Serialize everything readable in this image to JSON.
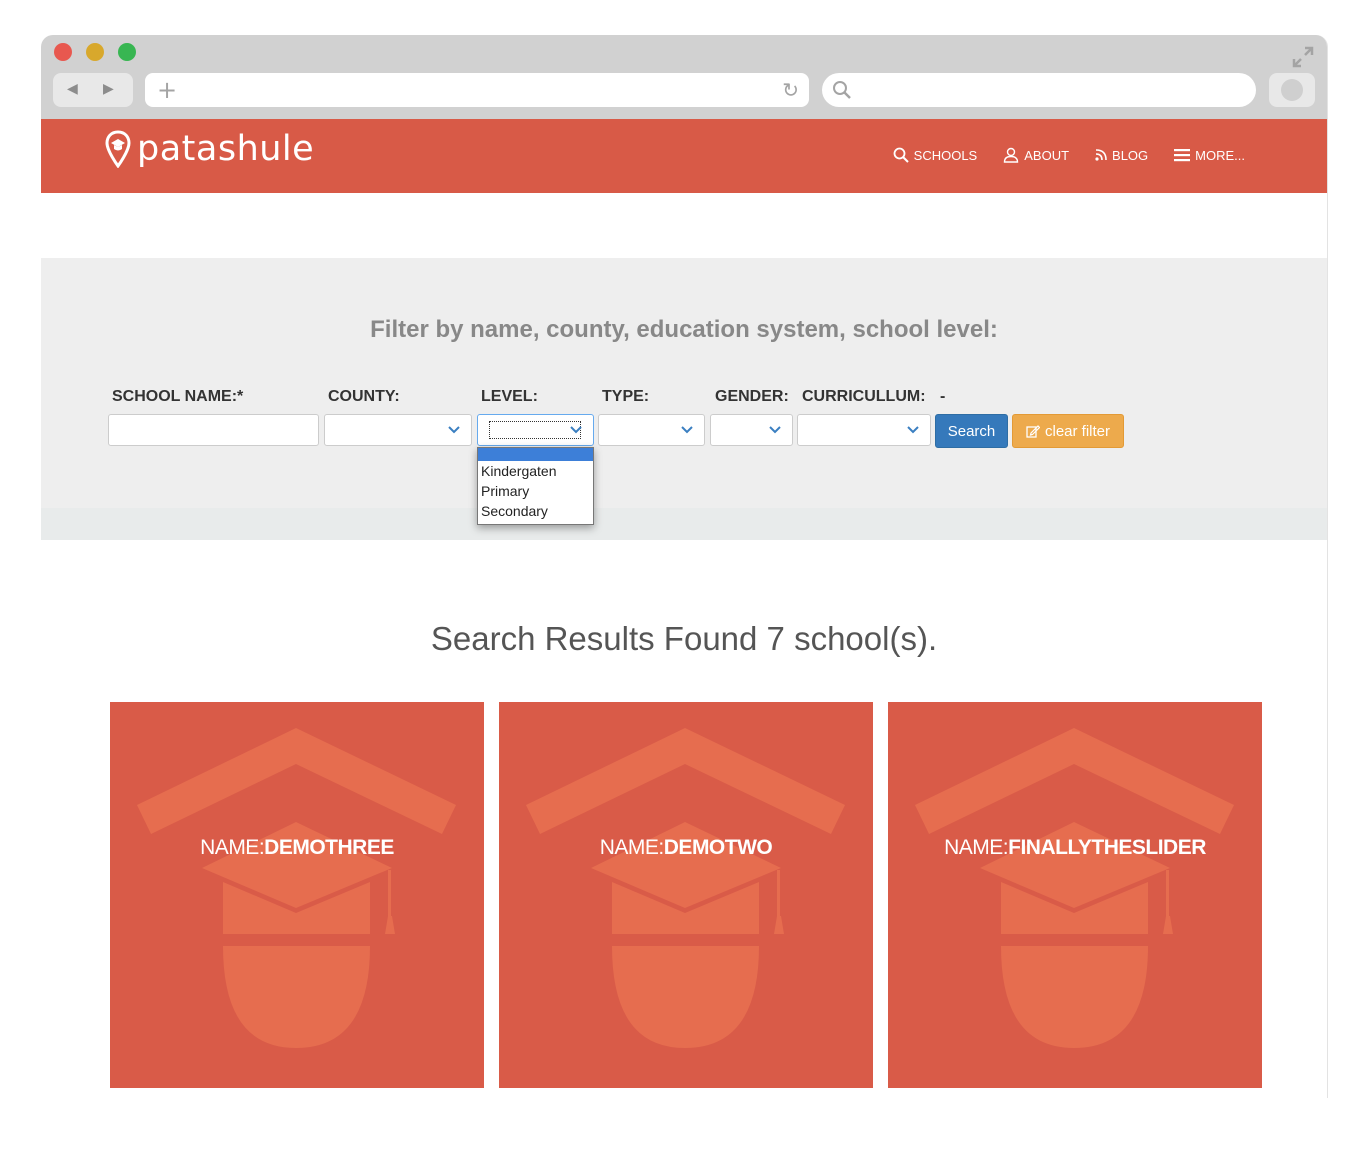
{
  "browser": {
    "back_icon": "triangle-left-icon",
    "forward_icon": "triangle-right-icon",
    "new_tab_icon": "plus-icon",
    "reload_icon": "reload-icon",
    "search_icon": "magnifier-icon",
    "expand_icon": "expand-icon"
  },
  "site": {
    "brand": "patashule",
    "brand_color": "#d85a47",
    "nav": [
      {
        "label": "SCHOOLS",
        "icon": "search-icon"
      },
      {
        "label": "ABOUT",
        "icon": "user-icon"
      },
      {
        "label": "BLOG",
        "icon": "rss-icon"
      },
      {
        "label": "MORE...",
        "icon": "menu-icon"
      }
    ]
  },
  "filter": {
    "title": "Filter by name, county, education system, school level:",
    "labels": {
      "school_name": "SCHOOL NAME:*",
      "county": "COUNTY:",
      "level": "LEVEL:",
      "type": "TYPE:",
      "gender": "GENDER:",
      "curriculum": "CURRICULLUM:",
      "dash": "-"
    },
    "school_name_value": "",
    "county_value": "",
    "level_value": "",
    "type_value": "",
    "gender_value": "",
    "curriculum_value": "",
    "search_label": "Search",
    "clear_label": "clear filter",
    "search_color": "#3579bb",
    "clear_color": "#edaa4c",
    "level_options": [
      "",
      "Kindergaten",
      "Primary",
      "Secondary"
    ]
  },
  "results": {
    "title": "Search Results Found 7 school(s).",
    "cards": [
      {
        "prefix": "NAME:",
        "name": "DEMOTHREE"
      },
      {
        "prefix": "NAME:",
        "name": "DEMOTWO"
      },
      {
        "prefix": "NAME:",
        "name": "FINALLYTHESLIDER"
      }
    ],
    "card_icon": "graduation-cap-icon"
  }
}
